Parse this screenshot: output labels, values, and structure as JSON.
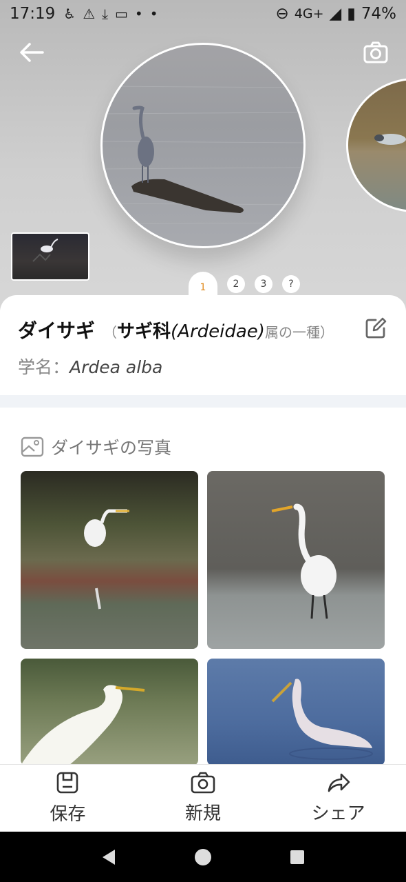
{
  "status_bar": {
    "time": "17:19",
    "network": "4G+",
    "battery": "74%"
  },
  "hero": {
    "pager_tabs": [
      "1",
      "2",
      "3",
      "?"
    ],
    "active_tab": "1"
  },
  "species": {
    "name": "ダイサギ",
    "paren_open": "（",
    "family": "サギ科",
    "family_latin": "(Ardeidae)",
    "genus_suffix": "属の一種）",
    "scientific_label": "学名：",
    "scientific_name": "Ardea alba"
  },
  "photos": {
    "heading": "ダイサギの写真"
  },
  "actions": {
    "save": "保存",
    "new": "新規",
    "share": "シェア"
  },
  "colors": {
    "accent": "#e08a1e"
  }
}
